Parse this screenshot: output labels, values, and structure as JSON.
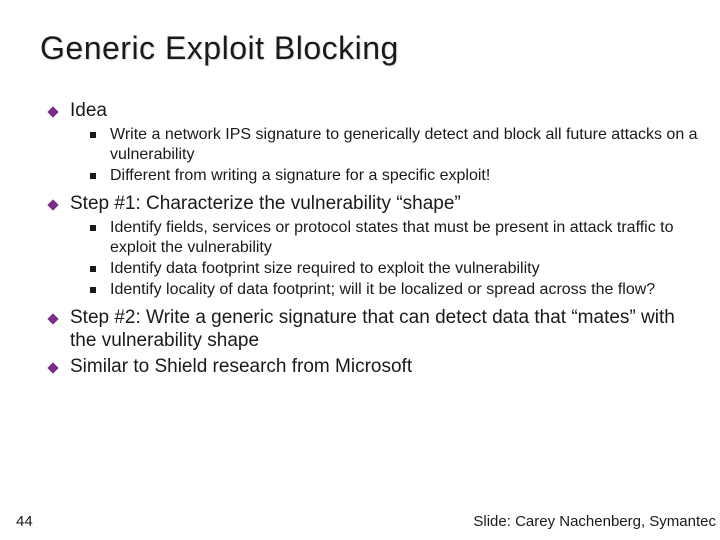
{
  "title": "Generic Exploit Blocking",
  "accent": "#7a2e8a",
  "bullets": [
    {
      "text": "Idea",
      "sub": [
        "Write a network IPS signature to generically detect and block all future attacks on a vulnerability",
        "Different from writing a signature for a specific exploit!"
      ]
    },
    {
      "text": "Step #1: Characterize the vulnerability “shape”",
      "sub": [
        "Identify fields, services or protocol states that must be present in attack traffic to exploit the vulnerability",
        "Identify data footprint size required to exploit the vulnerability",
        "Identify locality of data footprint; will it be localized or spread across the flow?"
      ]
    },
    {
      "text": "Step #2: Write a generic signature that can detect data that “mates” with the vulnerability shape",
      "sub": []
    },
    {
      "text": "Similar to Shield research from Microsoft",
      "sub": []
    }
  ],
  "page_number": "44",
  "credit": "Slide: Carey Nachenberg, Symantec"
}
